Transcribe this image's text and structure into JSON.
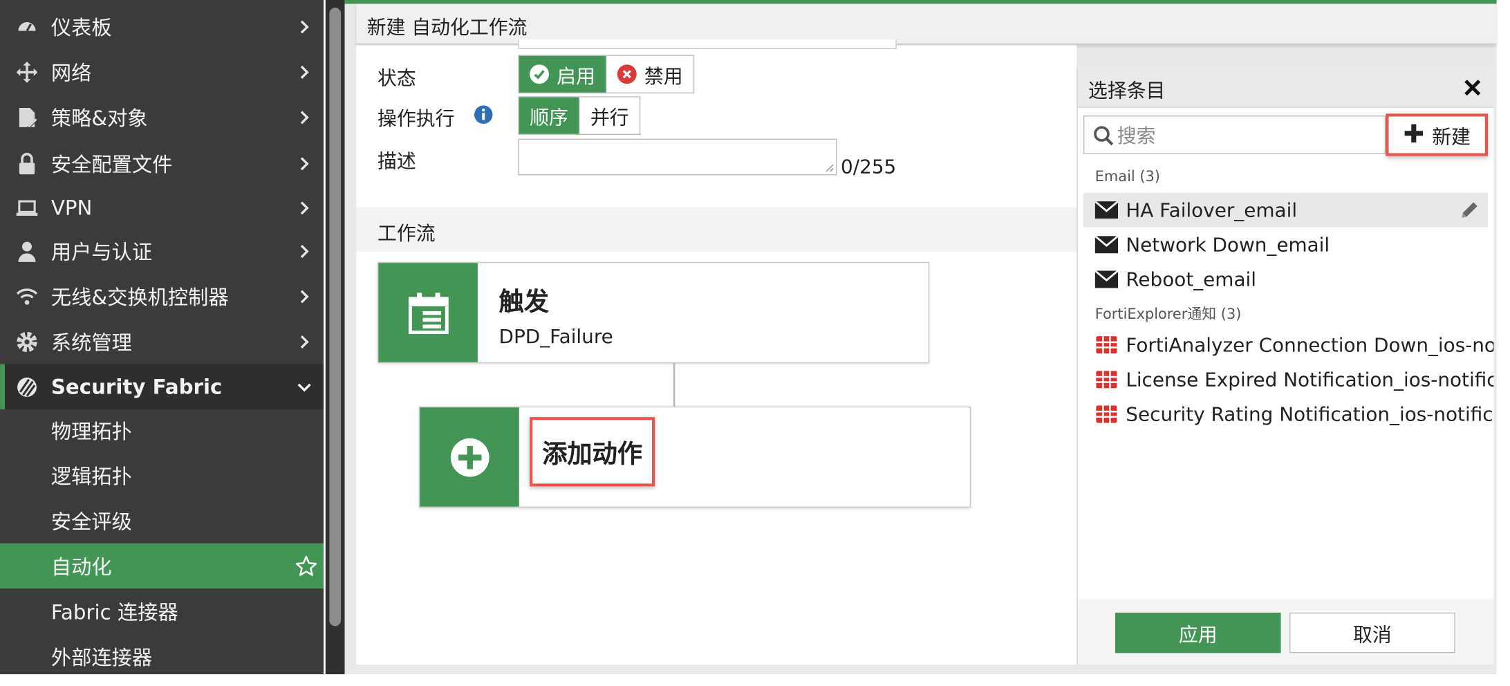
{
  "sidebar": {
    "items": [
      {
        "label": "仪表板",
        "icon": "dashboard-icon"
      },
      {
        "label": "网络",
        "icon": "network-icon"
      },
      {
        "label": "策略&对象",
        "icon": "policy-icon"
      },
      {
        "label": "安全配置文件",
        "icon": "lock-icon"
      },
      {
        "label": "VPN",
        "icon": "laptop-icon"
      },
      {
        "label": "用户与认证",
        "icon": "user-icon"
      },
      {
        "label": "无线&交换机控制器",
        "icon": "wifi-icon"
      },
      {
        "label": "系统管理",
        "icon": "gear-icon"
      },
      {
        "label": "Security Fabric",
        "icon": "fabric-icon"
      }
    ],
    "sub_items": [
      {
        "label": "物理拓扑"
      },
      {
        "label": "逻辑拓扑"
      },
      {
        "label": "安全评级"
      },
      {
        "label": "自动化"
      },
      {
        "label": "Fabric 连接器"
      },
      {
        "label": "外部连接器"
      }
    ],
    "accent_color": "#439556",
    "bg_color": "#3b3b3b"
  },
  "header": {
    "title": "新建 自动化工作流"
  },
  "form": {
    "status_label": "状态",
    "status_options": {
      "enable": "启用",
      "disable": "禁用"
    },
    "exec_label": "操作执行",
    "exec_options": {
      "sequential": "顺序",
      "parallel": "并行"
    },
    "desc_label": "描述",
    "desc_count": "0/255"
  },
  "workflow": {
    "section_title": "工作流",
    "trigger": {
      "title": "触发",
      "value": "DPD_Failure"
    },
    "add_action": {
      "label": "添加动作"
    }
  },
  "panel": {
    "title": "选择条目",
    "search_placeholder": "搜索",
    "new_label": "新建",
    "groups": [
      {
        "title": "Email (3)",
        "items": [
          "HA Failover_email",
          "Network Down_email",
          "Reboot_email"
        ]
      },
      {
        "title": "FortiExplorer通知 (3)",
        "items": [
          "FortiAnalyzer Connection Down_ios-notification",
          "License Expired Notification_ios-notification",
          "Security Rating Notification_ios-notification"
        ]
      }
    ],
    "apply_label": "应用",
    "cancel_label": "取消"
  }
}
